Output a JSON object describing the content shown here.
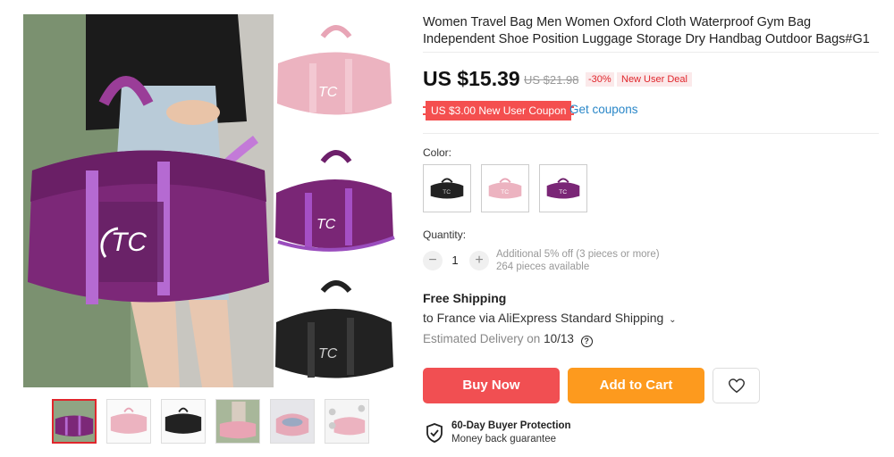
{
  "product": {
    "title": "Women Travel Bag Men Women Oxford Cloth Waterproof Gym Bag Independent Shoe Position Luggage Storage Dry Handbag Outdoor Bags#G1",
    "price": "US $15.39",
    "original_price": "US $21.98",
    "discount": "-30%",
    "deal_badge": "New User Deal"
  },
  "coupon": {
    "label": "US $3.00 New User Coupon",
    "link": "Get coupons"
  },
  "color": {
    "label": "Color:",
    "options": [
      "black",
      "pink",
      "purple"
    ]
  },
  "quantity": {
    "label": "Quantity:",
    "value": "1",
    "decrement": "−",
    "increment": "+",
    "discount_note": "Additional 5% off (3 pieces or more)",
    "available": "264 pieces available"
  },
  "shipping": {
    "title": "Free Shipping",
    "line": "to France via AliExpress Standard Shipping",
    "delivery_label": "Estimated Delivery on",
    "delivery_date": "10/13"
  },
  "actions": {
    "buy_now": "Buy Now",
    "add_to_cart": "Add to Cart"
  },
  "protection": {
    "title": "60-Day Buyer Protection",
    "subtitle": "Money back guarantee"
  },
  "gallery": {
    "main_colors": {
      "bag": "#7a2475",
      "trim": "#b36ad4",
      "logo": "#ffffff"
    },
    "thumbnails": [
      "purple-bag",
      "pink-bag",
      "black-bag",
      "model-pink",
      "bag-interior",
      "pink-bag-set"
    ]
  },
  "colors": {
    "accent": "#f14f52",
    "cart": "#fd9a1e",
    "link": "#2a87c8"
  }
}
